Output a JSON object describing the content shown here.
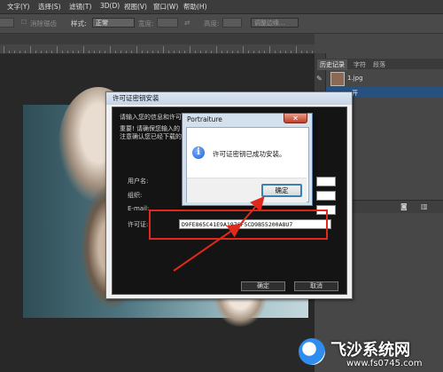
{
  "menubar": {
    "items": [
      "文字(Y)",
      "选择(S)",
      "滤镜(T)",
      "3D(D)",
      "视图(V)",
      "窗口(W)",
      "帮助(H)"
    ]
  },
  "options": {
    "antialias_label": "消除锯齿",
    "style_label": "样式:",
    "style_value": "正常",
    "width_label": "宽度:",
    "height_label": "高度:",
    "refine_button": "调整边缘..."
  },
  "panel": {
    "tabs": [
      "历史记录",
      "字符",
      "段落"
    ],
    "history_items": [
      "1.jpg",
      "开"
    ]
  },
  "license_dialog": {
    "title": "许可证密钥安装",
    "intro_line": "请输入您的信息和许可证密钥",
    "notice_line1": "重要! 请确保您输入的",
    "notice_line2": "注意确认您已经下载的",
    "username_label": "用户名:",
    "org_label": "组织:",
    "email_label": "E-mail:",
    "license_label": "许可证:",
    "license_value": "D9FE865C41E9A1976F5CD9B55200A8U7",
    "ok_button": "确定",
    "cancel_button": "取消"
  },
  "message_box": {
    "title": "Portraiture",
    "message": "许可证密钥已成功安装。",
    "ok_button": "确定",
    "close_glyph": "✕",
    "icon_glyph": "i"
  },
  "watermark": {
    "name": "飞沙系统网",
    "url": "www.fs0745.com"
  },
  "colors": {
    "highlight_red": "#e0281c",
    "selection_blue": "#26507f",
    "dialog_title": "#c5d4e6"
  }
}
